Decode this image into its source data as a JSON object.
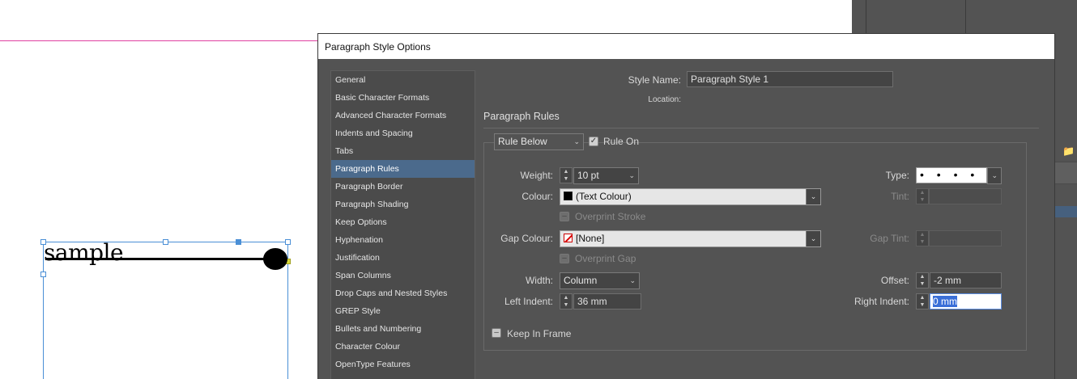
{
  "document": {
    "sample_text": "sample"
  },
  "dialog": {
    "title": "Paragraph Style Options",
    "style_name_label": "Style Name:",
    "style_name_value": "Paragraph Style 1",
    "location_label": "Location:",
    "section_title": "Paragraph Rules"
  },
  "sidebar": {
    "items": [
      {
        "label": "General"
      },
      {
        "label": "Basic Character Formats"
      },
      {
        "label": "Advanced Character Formats"
      },
      {
        "label": "Indents and Spacing"
      },
      {
        "label": "Tabs"
      },
      {
        "label": "Paragraph Rules",
        "active": true
      },
      {
        "label": "Paragraph Border"
      },
      {
        "label": "Paragraph Shading"
      },
      {
        "label": "Keep Options"
      },
      {
        "label": "Hyphenation"
      },
      {
        "label": "Justification"
      },
      {
        "label": "Span Columns"
      },
      {
        "label": "Drop Caps and Nested Styles"
      },
      {
        "label": "GREP Style"
      },
      {
        "label": "Bullets and Numbering"
      },
      {
        "label": "Character Colour"
      },
      {
        "label": "OpenType Features"
      }
    ]
  },
  "rules": {
    "rule_select": "Rule Below",
    "rule_on_label": "Rule On",
    "rule_on_checked": true,
    "weight_label": "Weight:",
    "weight_value": "10 pt",
    "type_label": "Type:",
    "type_value": "• • • •",
    "colour_label": "Colour:",
    "colour_value": "(Text Colour)",
    "tint_label": "Tint:",
    "overprint_stroke_label": "Overprint Stroke",
    "gap_colour_label": "Gap Colour:",
    "gap_colour_value": "[None]",
    "gap_tint_label": "Gap Tint:",
    "overprint_gap_label": "Overprint Gap",
    "width_label": "Width:",
    "width_value": "Column",
    "offset_label": "Offset:",
    "offset_value": "-2 mm",
    "left_indent_label": "Left Indent:",
    "left_indent_value": "36 mm",
    "right_indent_label": "Right Indent:",
    "right_indent_value": "0 mm",
    "keep_in_frame_label": "Keep In Frame",
    "keep_in_frame_checked": false
  },
  "colors": {
    "dialog_bg": "#535353",
    "active_item": "#4b6a8c",
    "margin_guide": "#e040a0",
    "frame_edge": "#4a8fd6"
  },
  "icons": [
    "chevron-down-icon",
    "stepper-icon",
    "checkmark-icon",
    "folder-icon",
    "color-swatch-icon"
  ]
}
